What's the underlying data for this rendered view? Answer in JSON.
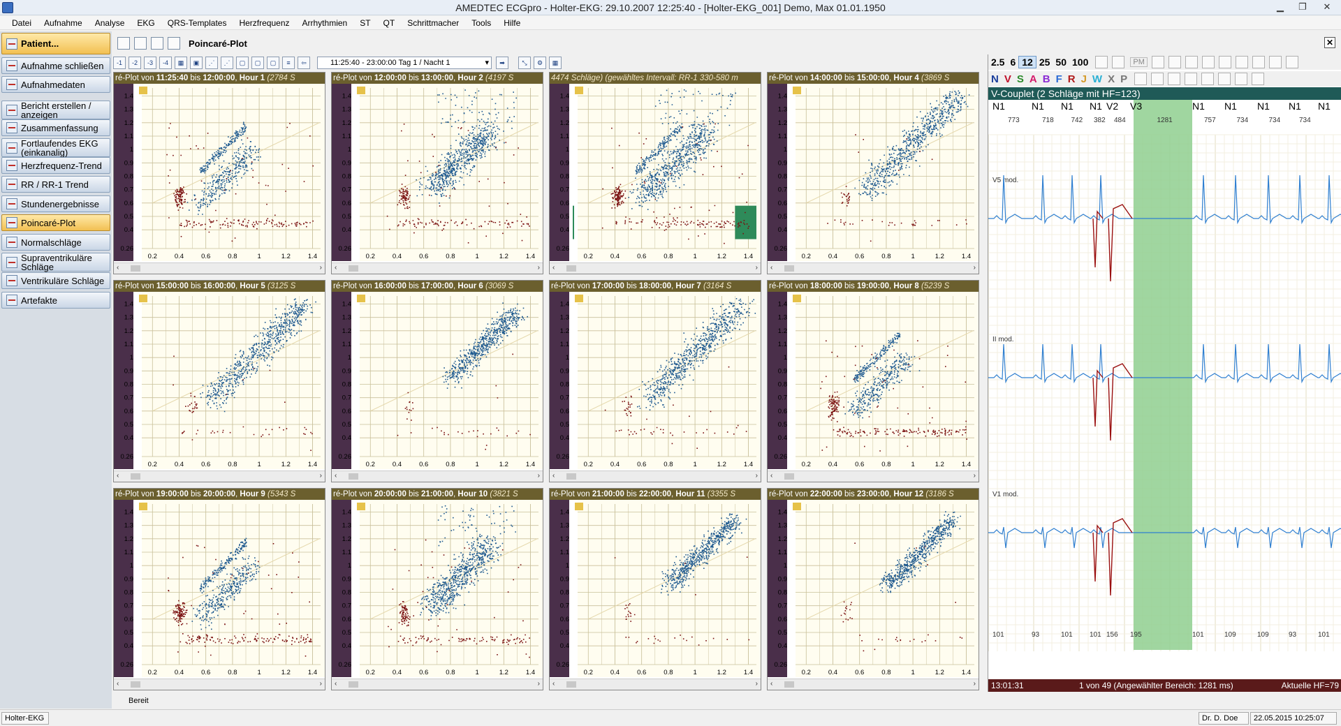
{
  "window": {
    "title": "AMEDTEC ECGpro   -   Holter-EKG: 29.10.2007 12:25:40   -   [Holter-EKG_001] Demo, Max 01.01.1950"
  },
  "menu": [
    "Datei",
    "Aufnahme",
    "Analyse",
    "EKG",
    "QRS-Templates",
    "Herzfrequenz",
    "Arrhythmien",
    "ST",
    "QT",
    "Schrittmacher",
    "Tools",
    "Hilfe"
  ],
  "sidebar": {
    "items": [
      {
        "label": "Patient...",
        "active": true,
        "bold": true
      },
      {
        "label": "Aufnahme schließen"
      },
      {
        "label": "Aufnahmedaten"
      },
      {
        "label": "Bericht erstellen / anzeigen"
      },
      {
        "label": "Zusammenfassung"
      },
      {
        "label": "Fortlaufendes EKG (einkanalig)"
      },
      {
        "label": "Herzfrequenz-Trend"
      },
      {
        "label": "RR / RR-1 Trend"
      },
      {
        "label": "Stundenergebnisse"
      },
      {
        "label": "Poincaré-Plot",
        "active": true
      },
      {
        "label": "Normalschläge"
      },
      {
        "label": "Supraventrikuläre Schläge"
      },
      {
        "label": "Ventrikuläre Schläge"
      },
      {
        "label": "Artefakte"
      }
    ]
  },
  "content": {
    "title": "Poincaré-Plot",
    "range_select": "11:25:40 - 23:00:00 Tag 1 / Nacht 1",
    "toolbar_icons": [
      "1-icon",
      "2-icon",
      "3-icon",
      "4-icon"
    ],
    "status_text": "Bereit"
  },
  "plots": [
    {
      "prefix": "ré-Plot von ",
      "from": "11:25:40",
      "to": "12:00:00",
      "hour": "Hour 1",
      "beats": "(2784 S",
      "shape": "A",
      "selection": false
    },
    {
      "prefix": "ré-Plot von ",
      "from": "12:00:00",
      "to": "13:00:00",
      "hour": "Hour 2",
      "beats": "(4197 S",
      "shape": "B",
      "selection": false
    },
    {
      "prefix": "",
      "from": "",
      "to": "",
      "hour": "",
      "beats": "4474 Schläge) (gewähltes Intervall: RR-1 330-580 m",
      "shape": "C",
      "selection": true
    },
    {
      "prefix": "ré-Plot von ",
      "from": "14:00:00",
      "to": "15:00:00",
      "hour": "Hour 4",
      "beats": "(3869 S",
      "shape": "D",
      "selection": false
    },
    {
      "prefix": "ré-Plot von ",
      "from": "15:00:00",
      "to": "16:00:00",
      "hour": "Hour 5",
      "beats": "(3125 S",
      "shape": "D",
      "selection": false
    },
    {
      "prefix": "ré-Plot von ",
      "from": "16:00:00",
      "to": "17:00:00",
      "hour": "Hour 6",
      "beats": "(3069 S",
      "shape": "E",
      "selection": false
    },
    {
      "prefix": "ré-Plot von ",
      "from": "17:00:00",
      "to": "18:00:00",
      "hour": "Hour 7",
      "beats": "(3164 S",
      "shape": "D",
      "selection": false
    },
    {
      "prefix": "ré-Plot von ",
      "from": "18:00:00",
      "to": "19:00:00",
      "hour": "Hour 8",
      "beats": "(5239 S",
      "shape": "A",
      "selection": false
    },
    {
      "prefix": "ré-Plot von ",
      "from": "19:00:00",
      "to": "20:00:00",
      "hour": "Hour 9",
      "beats": "(5343 S",
      "shape": "A",
      "selection": false
    },
    {
      "prefix": "ré-Plot von ",
      "from": "20:00:00",
      "to": "21:00:00",
      "hour": "Hour 10",
      "beats": "(3821 S",
      "shape": "B",
      "selection": false
    },
    {
      "prefix": "ré-Plot von ",
      "from": "21:00:00",
      "to": "22:00:00",
      "hour": "Hour 11",
      "beats": "(3355 S",
      "shape": "E",
      "selection": false
    },
    {
      "prefix": "ré-Plot von ",
      "from": "22:00:00",
      "to": "23:00:00",
      "hour": "Hour 12",
      "beats": "(3186 S",
      "shape": "E",
      "selection": false
    }
  ],
  "axis": {
    "yticks": [
      "1.4",
      "1.3",
      "1.2",
      "1.1",
      "1",
      "0.9",
      "0.8",
      "0.7",
      "0.6",
      "0.5",
      "0.4",
      "0.26"
    ],
    "xticks": [
      "0.2",
      "0.4",
      "0.6",
      "0.8",
      "1",
      "1.2",
      "1.4"
    ]
  },
  "ecg": {
    "speeds": [
      "2.5",
      "6",
      "12",
      "25",
      "50",
      "100"
    ],
    "speed_selected": "12",
    "pm_label": "PM",
    "classes": [
      {
        "label": "N",
        "color": "#1b3f9c"
      },
      {
        "label": "V",
        "color": "#c0102a"
      },
      {
        "label": "S",
        "color": "#2a8a2a"
      },
      {
        "label": "A",
        "color": "#d41a6a"
      },
      {
        "label": "B",
        "color": "#8a2ad4"
      },
      {
        "label": "F",
        "color": "#2a6ad4"
      },
      {
        "label": "R",
        "color": "#b01a1a"
      },
      {
        "label": "J",
        "color": "#d49a2a"
      },
      {
        "label": "W",
        "color": "#2ab0d4"
      },
      {
        "label": "X",
        "color": "#777777"
      },
      {
        "label": "P",
        "color": "#777777"
      }
    ],
    "event": "V-Couplet (2 Schläge mit HF=123)",
    "beat_labels": [
      "N1",
      "N1",
      "N1",
      "N1",
      "V2",
      "V3",
      "N1",
      "N1",
      "N1",
      "N1",
      "N1"
    ],
    "rr_values": [
      "773",
      "718",
      "742",
      "382",
      "484",
      "1281",
      "757",
      "734",
      "734",
      "734"
    ],
    "hr_values": [
      "101",
      "93",
      "101",
      "101",
      "156",
      "195",
      "101",
      "109",
      "109",
      "93",
      "101"
    ],
    "leads": [
      "V5 mod.",
      "II mod.",
      "V1 mod."
    ],
    "status_time": "13:01:31",
    "status_mid": "1 von 49 (Angewählter Bereich: 1281 ms)",
    "status_right": "Aktuelle HF=79"
  },
  "statusbar": {
    "left": "Holter-EKG",
    "user": "Dr. D. Doe",
    "datetime": "22.05.2015 10:25:07"
  },
  "colors": {
    "normal": "#1f5a8f",
    "ectopic": "#7a1010",
    "plot_bg": "#fffdf0",
    "grid": "#c9c09a",
    "axis_bg": "#4a2f4a",
    "header": "#6b5f2e",
    "highlight": "#8fcf8f"
  }
}
